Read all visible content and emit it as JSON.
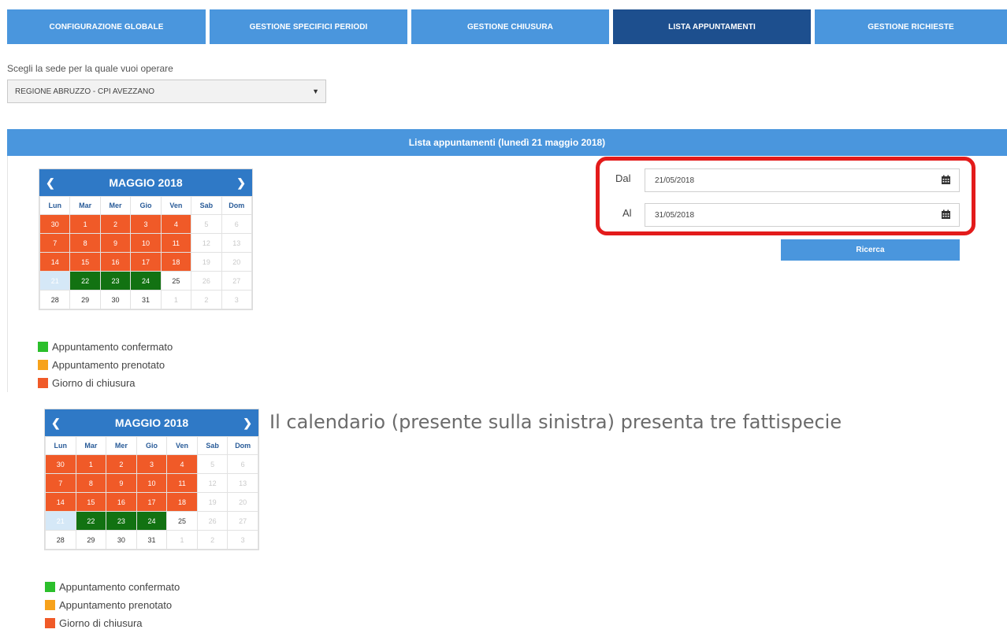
{
  "nav": {
    "tabs": [
      {
        "label": "CONFIGURAZIONE GLOBALE",
        "active": false
      },
      {
        "label": "GESTIONE SPECIFICI PERIODI",
        "active": false
      },
      {
        "label": "GESTIONE CHIUSURA",
        "active": false
      },
      {
        "label": "LISTA APPUNTAMENTI",
        "active": true
      },
      {
        "label": "GESTIONE RICHIESTE",
        "active": false
      }
    ]
  },
  "site": {
    "label": "Scegli la sede per la quale vuoi operare",
    "selected": "REGIONE ABRUZZO - CPI AVEZZANO"
  },
  "list_header": "Lista appuntamenti (lunedì 21 maggio 2018)",
  "calendar": {
    "title": "MAGGIO 2018",
    "weekdays": [
      "Lun",
      "Mar",
      "Mer",
      "Gio",
      "Ven",
      "Sab",
      "Dom"
    ],
    "weeks": [
      [
        {
          "d": "30",
          "s": "closed"
        },
        {
          "d": "1",
          "s": "closed"
        },
        {
          "d": "2",
          "s": "closed"
        },
        {
          "d": "3",
          "s": "closed"
        },
        {
          "d": "4",
          "s": "closed"
        },
        {
          "d": "5",
          "s": "disabled"
        },
        {
          "d": "6",
          "s": "disabled"
        }
      ],
      [
        {
          "d": "7",
          "s": "closed"
        },
        {
          "d": "8",
          "s": "closed"
        },
        {
          "d": "9",
          "s": "closed"
        },
        {
          "d": "10",
          "s": "closed"
        },
        {
          "d": "11",
          "s": "closed"
        },
        {
          "d": "12",
          "s": "disabled"
        },
        {
          "d": "13",
          "s": "disabled"
        }
      ],
      [
        {
          "d": "14",
          "s": "closed"
        },
        {
          "d": "15",
          "s": "closed"
        },
        {
          "d": "16",
          "s": "closed"
        },
        {
          "d": "17",
          "s": "closed"
        },
        {
          "d": "18",
          "s": "closed"
        },
        {
          "d": "19",
          "s": "disabled"
        },
        {
          "d": "20",
          "s": "disabled"
        }
      ],
      [
        {
          "d": "21",
          "s": "today"
        },
        {
          "d": "22",
          "s": "confirmed"
        },
        {
          "d": "23",
          "s": "confirmed"
        },
        {
          "d": "24",
          "s": "confirmed"
        },
        {
          "d": "25",
          "s": "normal"
        },
        {
          "d": "26",
          "s": "disabled"
        },
        {
          "d": "27",
          "s": "disabled"
        }
      ],
      [
        {
          "d": "28",
          "s": "normal"
        },
        {
          "d": "29",
          "s": "normal"
        },
        {
          "d": "30",
          "s": "normal"
        },
        {
          "d": "31",
          "s": "normal"
        },
        {
          "d": "1",
          "s": "disabled"
        },
        {
          "d": "2",
          "s": "disabled"
        },
        {
          "d": "3",
          "s": "disabled"
        }
      ]
    ]
  },
  "legend": [
    {
      "label": "Appuntamento confermato",
      "color": "#2bbf2b"
    },
    {
      "label": "Appuntamento prenotato",
      "color": "#f7a21b"
    },
    {
      "label": "Giorno di chiusura",
      "color": "#f05a28"
    }
  ],
  "date_range": {
    "from_label": "Dal",
    "from_value": "21/05/2018",
    "to_label": "Al",
    "to_value": "31/05/2018"
  },
  "search_button": "Ricerca",
  "description": "Il calendario (presente sulla sinistra) presenta tre fattispecie"
}
